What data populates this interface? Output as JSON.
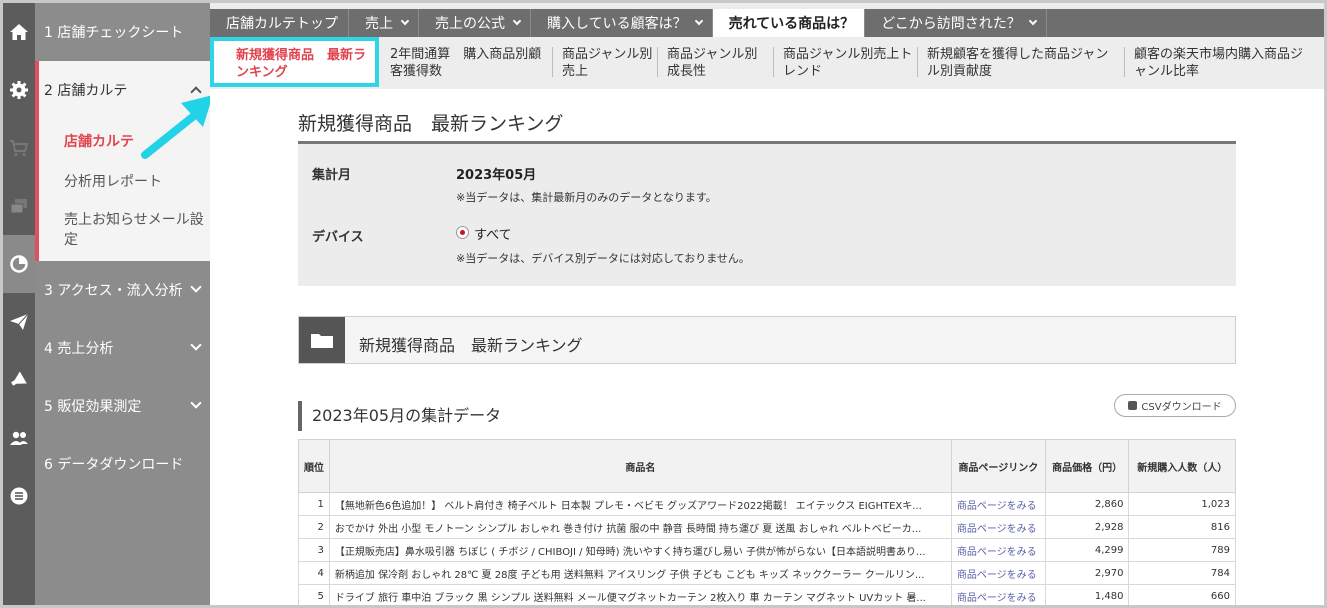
{
  "rail": [
    "home-icon",
    "gear-icon",
    "cart-icon",
    "cards-icon",
    "pie-chart-icon",
    "send-icon",
    "megaphone-icon",
    "users-icon",
    "list-icon"
  ],
  "sidebar": {
    "sections": [
      {
        "label": "1 店舗チェックシート"
      },
      {
        "label": "2 店舗カルテ"
      },
      {
        "label": "3 アクセス・流入分析"
      },
      {
        "label": "4 売上分析"
      },
      {
        "label": "5 販促効果測定"
      },
      {
        "label": "6 データダウンロード"
      }
    ],
    "sub_items": [
      "店舗カルテ",
      "分析用レポート",
      "売上お知らせメール設定"
    ]
  },
  "tabs": [
    {
      "label": "店舗カルテトップ"
    },
    {
      "label": "売上"
    },
    {
      "label": "売上の公式"
    },
    {
      "label": "購入している顧客は？"
    },
    {
      "label": "売れている商品は？"
    },
    {
      "label": "どこから訪問された？"
    }
  ],
  "subnav": {
    "active": "新規獲得商品　最新ランキング",
    "items": [
      "2年間通算　購入商品別顧客獲得数",
      "商品ジャンル別売上",
      "商品ジャンル別成長性",
      "商品ジャンル別売上トレンド",
      "新規顧客を獲得した商品ジャンル別貢献度",
      "顧客の楽天市場内購入商品ジャンル比率"
    ]
  },
  "main": {
    "title": "新規獲得商品　最新ランキング",
    "period_label": "集計月",
    "period_value": "2023年05月",
    "period_note": "※当データは、集計最新月のみのデータとなります。",
    "device_label": "デバイス",
    "device_value": "すべて",
    "device_note": "※当データは、デバイス別データには対応しておりません。",
    "box_title": "新規獲得商品　最新ランキング",
    "agg_title": "2023年05月の集計データ",
    "csv_label": "CSVダウンロード"
  },
  "table": {
    "headers": [
      "順位",
      "商品名",
      "商品ページリンク",
      "商品価格（円）",
      "新規購入人数（人）"
    ],
    "rows": [
      {
        "rank": "1",
        "name": "【無地新色6色追加！】 ベルト肩付き 椅子ベルト 日本製 プレモ・ベビモ グッズアワード2022掲載！ エイテックス EIGHTEXキ...",
        "link": "商品ページをみる",
        "price": "2,860",
        "buyers": "1,023"
      },
      {
        "rank": "2",
        "name": "おでかけ 外出 小型 モノトーン シンプル おしゃれ 巻き付け 抗菌 服の中 静音 長時間 持ち運び 夏 送風 おしゃれ ベルトベビーカ...",
        "link": "商品ページをみる",
        "price": "2,928",
        "buyers": "816"
      },
      {
        "rank": "3",
        "name": "【正規販売店】鼻水吸引器 ちぼじ ( チボジ / CHIBOJI / 知母時) 洗いやすく持ち運びし易い 子供が怖がらない【日本語説明書あり...",
        "link": "商品ページをみる",
        "price": "4,299",
        "buyers": "789"
      },
      {
        "rank": "4",
        "name": "新柄追加 保冷剤 おしゃれ 28℃ 夏 28度 子ども用 送料無料 アイスリング 子供 子ども こども キッズ ネッククーラー クールリン...",
        "link": "商品ページをみる",
        "price": "2,970",
        "buyers": "784"
      },
      {
        "rank": "5",
        "name": "ドライブ 旅行 車中泊 ブラック 黒 シンプル 送料無料 メール便マグネットカーテン 2枚入り 車 カーテン マグネット UVカット 暑...",
        "link": "商品ページをみる",
        "price": "1,480",
        "buyers": "660"
      }
    ]
  },
  "colors": {
    "accent": "#e0454f",
    "highlight": "#2fd5e6",
    "arrow": "#22d3e8"
  }
}
